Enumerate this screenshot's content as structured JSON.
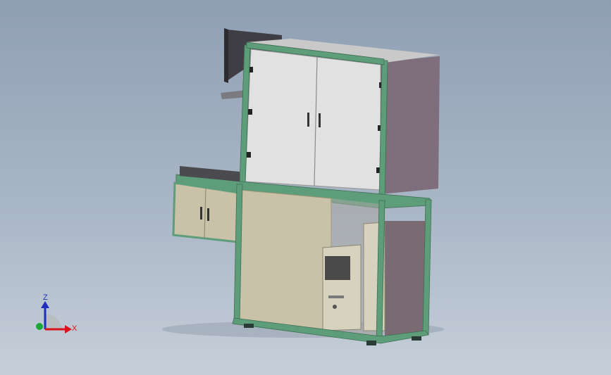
{
  "viewport": {
    "background_top": "#8f9fb3",
    "background_bottom": "#c6cfd9"
  },
  "model": {
    "frame_color": "#5e9d7a",
    "cabinet_face_color": "#dcdcdc",
    "cabinet_side_color": "#7f6f7d",
    "lower_panel_color": "#c9c2a8",
    "computer_tower_color": "#d6d2bd"
  },
  "triad": {
    "z_label": "Z",
    "x_label": "X",
    "z_color": "#1c2fb8",
    "x_color": "#d8141c",
    "y_color": "#1aa83a"
  }
}
